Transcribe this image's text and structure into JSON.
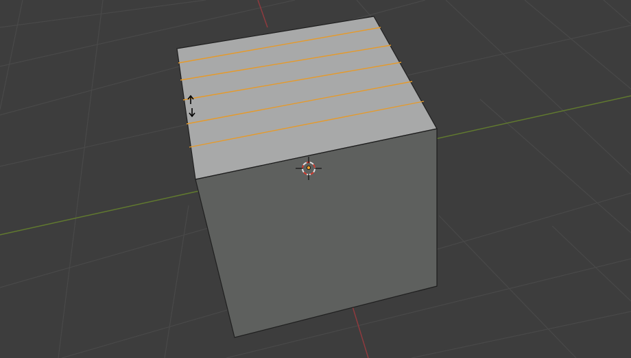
{
  "viewport": {
    "mode": "edit-mode",
    "operation": "loop-cut-and-slide",
    "loop_cut_count": 5
  },
  "scene": {
    "background_color": "#3d3d3d",
    "grid_color": "#494949",
    "x_axis_color": "#617a2f",
    "y_axis_color": "#8f3a3e",
    "cube_top_color": "#a8a9a9",
    "cube_front_color": "#5e605e",
    "cube_side_color": "#6b6e6b",
    "edge_color": "#1f1f1f",
    "loop_cut_color": "#e59a2b",
    "cursor_color": "#e2e2e2",
    "origin_color": "#f4a12c"
  },
  "icons": {
    "cursor": "3d-cursor-icon",
    "origin": "object-origin-icon",
    "slide": "vertical-resize-cursor-icon"
  }
}
